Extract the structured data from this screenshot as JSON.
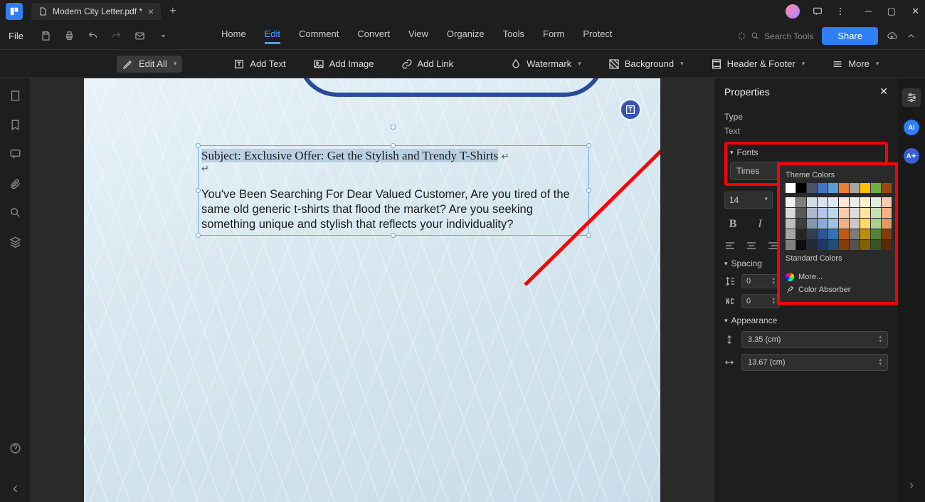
{
  "titlebar": {
    "tab_name": "Modern City Letter.pdf *"
  },
  "menubar": {
    "file": "File",
    "nav": [
      "Home",
      "Edit",
      "Comment",
      "Convert",
      "View",
      "Organize",
      "Tools",
      "Form",
      "Protect"
    ],
    "active_index": 1,
    "search_placeholder": "Search Tools",
    "share": "Share"
  },
  "toolbar": {
    "edit_all": "Edit All",
    "add_text": "Add Text",
    "add_image": "Add Image",
    "add_link": "Add Link",
    "watermark": "Watermark",
    "background": "Background",
    "header_footer": "Header & Footer",
    "more": "More"
  },
  "document": {
    "subject": "Subject: Exclusive Offer: Get the Stylish and Trendy T-Shirts",
    "body": "You've Been Searching For Dear Valued Customer, Are you tired of the same old generic t-shirts that flood the market? Are you seeking something unique and stylish that reflects your individuality?"
  },
  "properties": {
    "title": "Properties",
    "type_label": "Type",
    "type_value": "Text",
    "fonts_label": "Fonts",
    "font_family": "Times",
    "font_size": "14",
    "spacing_label": "Spacing",
    "spacing_line": "0",
    "spacing_char": "0",
    "appearance_label": "Appearance",
    "width": "3.35",
    "width_unit": "(cm)",
    "height": "13.67",
    "height_unit": "(cm)"
  },
  "color_popup": {
    "theme_title": "Theme Colors",
    "standard_title": "Standard Colors",
    "more": "More...",
    "absorber": "Color Absorber",
    "theme_row1": [
      "#ffffff",
      "#000000",
      "#44546a",
      "#4472c4",
      "#5b9bd5",
      "#ed7d31",
      "#a5a5a5",
      "#ffc000",
      "#70ad47",
      "#9e480e"
    ],
    "theme_shades": [
      [
        "#f2f2f2",
        "#7f7f7f",
        "#d6dce5",
        "#d9e1f2",
        "#deeaf6",
        "#fbe5d6",
        "#ededed",
        "#fff2cc",
        "#e2efda",
        "#f7cbac"
      ],
      [
        "#d9d9d9",
        "#595959",
        "#adb9ca",
        "#b4c6e7",
        "#bdd7ee",
        "#f8cbad",
        "#dbdbdb",
        "#ffe699",
        "#c6e0b4",
        "#f4b084"
      ],
      [
        "#bfbfbf",
        "#404040",
        "#8497b0",
        "#8ea9db",
        "#9bc2e6",
        "#f4b084",
        "#c9c9c9",
        "#ffd966",
        "#a9d08e",
        "#e2995e"
      ],
      [
        "#a6a6a6",
        "#262626",
        "#333f4f",
        "#305496",
        "#2e75b6",
        "#c65911",
        "#7b7b7b",
        "#bf8f00",
        "#548235",
        "#833c0c"
      ],
      [
        "#808080",
        "#0d0d0d",
        "#222b35",
        "#203764",
        "#1f4e78",
        "#843c0b",
        "#525252",
        "#806000",
        "#375623",
        "#5a2a08"
      ]
    ],
    "standard": [
      "#c00000",
      "#ff0000",
      "#ffc000",
      "#ffff00",
      "#92d050",
      "#00b050",
      "#00b0f0",
      "#0070c0",
      "#002060",
      "#7030a0"
    ]
  }
}
